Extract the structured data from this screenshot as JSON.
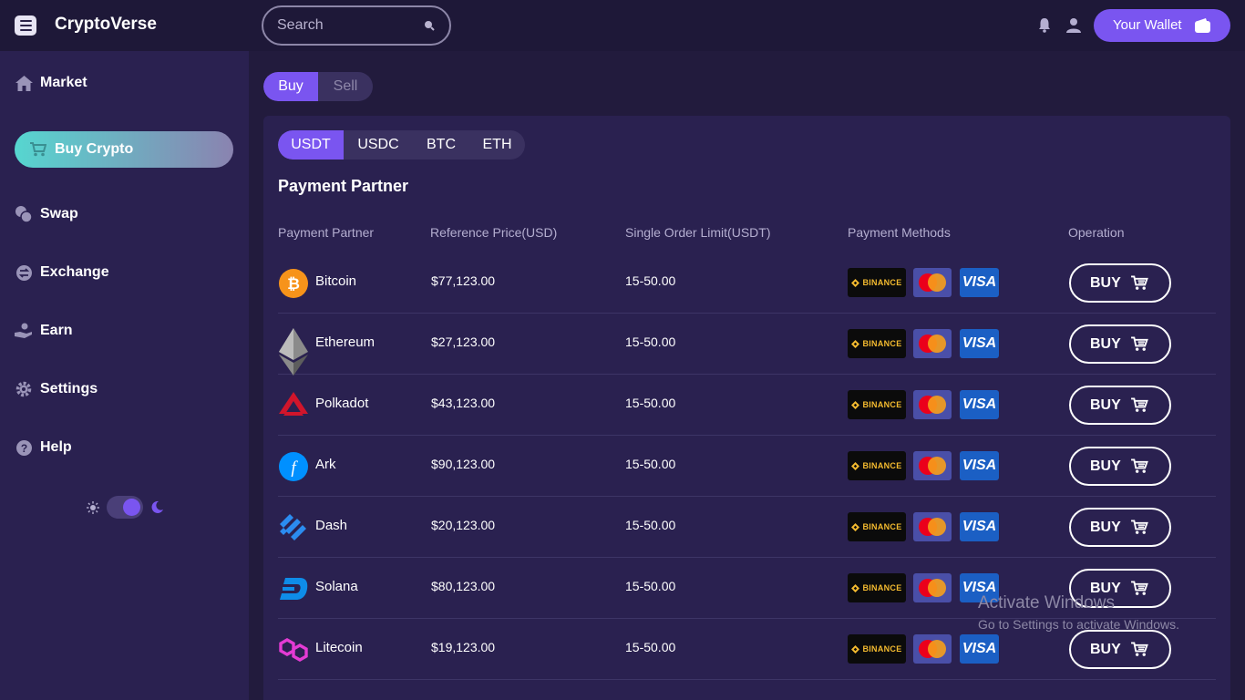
{
  "app": {
    "name": "CryptoVerse"
  },
  "search": {
    "placeholder": "Search"
  },
  "header": {
    "wallet_label": "Your Wallet"
  },
  "sidebar": {
    "items": [
      {
        "label": "Market",
        "icon": "home-icon"
      },
      {
        "label": "Buy Crypto",
        "icon": "cart-icon",
        "active": true
      },
      {
        "label": "Swap",
        "icon": "swap-coins-icon"
      },
      {
        "label": "Exchange",
        "icon": "exchange-icon"
      },
      {
        "label": "Earn",
        "icon": "earn-hand-icon"
      },
      {
        "label": "Settings",
        "icon": "gear-icon"
      },
      {
        "label": "Help",
        "icon": "help-icon"
      }
    ],
    "theme": "dark"
  },
  "trade_mode": {
    "buy": "Buy",
    "sell": "Sell",
    "selected": "Buy"
  },
  "coin_tabs": {
    "items": [
      "USDT",
      "USDC",
      "BTC",
      "ETH"
    ],
    "selected": "USDT"
  },
  "section_title": "Payment Partner",
  "table": {
    "headers": [
      "Payment Partner",
      "Reference Price(USD)",
      "Single Order Limit(USDT)",
      "Payment Methods",
      "Operation"
    ],
    "rows": [
      {
        "name": "Bitcoin",
        "price": "$77,123.00",
        "limit": "15-50.00",
        "logo": "bitcoin-logo-icon"
      },
      {
        "name": "Ethereum",
        "price": "$27,123.00",
        "limit": "15-50.00",
        "logo": "ethereum-logo-icon"
      },
      {
        "name": "Polkadot",
        "price": "$43,123.00",
        "limit": "15-50.00",
        "logo": "polkadot-logo-icon"
      },
      {
        "name": "Ark",
        "price": "$90,123.00",
        "limit": "15-50.00",
        "logo": "ark-logo-icon"
      },
      {
        "name": "Dash",
        "price": "$20,123.00",
        "limit": "15-50.00",
        "logo": "dash-logo-icon"
      },
      {
        "name": "Solana",
        "price": "$80,123.00",
        "limit": "15-50.00",
        "logo": "solana-logo-icon"
      },
      {
        "name": "Litecoin",
        "price": "$19,123.00",
        "limit": "15-50.00",
        "logo": "litecoin-logo-icon"
      }
    ],
    "payment_methods": {
      "binance": "BINANCE",
      "mastercard": "",
      "visa": "VISA"
    },
    "buy_label": "BUY"
  },
  "watermark": {
    "line1": "Activate Windows",
    "line2": "Go to Settings to activate Windows."
  },
  "colors": {
    "accent": "#7a55f0",
    "background": "#221b3d",
    "sidebar": "#2a2150",
    "active_gradient_start": "#56d6d0"
  }
}
